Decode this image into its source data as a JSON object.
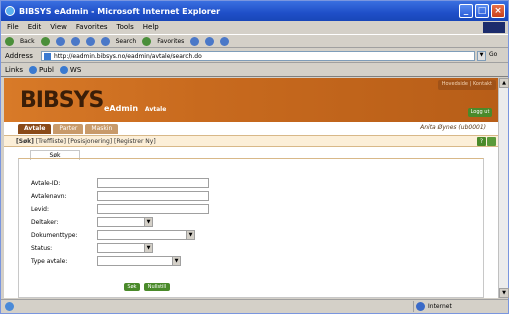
{
  "window": {
    "title": "BIBSYS eAdmin - Microsoft Internet Explorer"
  },
  "menu": [
    "File",
    "Edit",
    "View",
    "Favorites",
    "Tools",
    "Help"
  ],
  "toolbar": {
    "back": "Back",
    "search": "Search",
    "favorites": "Favorites"
  },
  "address": {
    "label": "Address",
    "url": "http://eadmin.bibsys.no/eadmin/avtale/search.do",
    "go": "Go"
  },
  "links": {
    "label": "Links",
    "items": [
      "Publ",
      "WS"
    ]
  },
  "banner": {
    "logo": "BIBSYS",
    "app": "eAdmin",
    "section": "Avtale",
    "help": "Hovedside | Kontakt",
    "logout": "Logg ut"
  },
  "tabs": [
    "Avtale",
    "Parter",
    "Maskin"
  ],
  "user": "Anita Øynes (ub0001)",
  "subnav": {
    "active": "[Søk]",
    "rest": " [Treffliste] [Posisjonering] [Registrer Ny]"
  },
  "search_tab": "Søk",
  "form": {
    "fields": [
      {
        "label": "Avtale-ID:"
      },
      {
        "label": "Avtalenavn:"
      },
      {
        "label": "Levid:"
      },
      {
        "label": "Deltaker:"
      },
      {
        "label": "Dokumenttype:"
      },
      {
        "label": "Status:"
      },
      {
        "label": "Type avtale:"
      }
    ],
    "search_button": "Søk",
    "reset_button": "Nullstill"
  },
  "status": {
    "zone": "Internet"
  }
}
